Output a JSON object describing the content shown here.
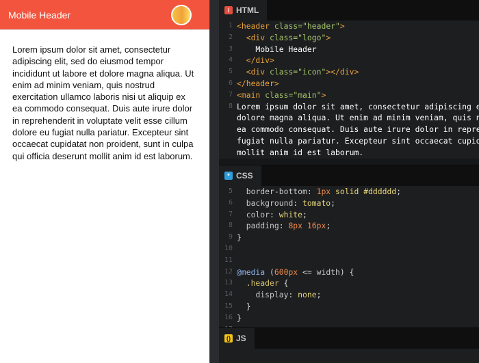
{
  "preview": {
    "header_title": "Mobile Header",
    "body_text": "Lorem ipsum dolor sit amet, consectetur adipiscing elit, sed do eiusmod tempor incididunt ut labore et dolore magna aliqua. Ut enim ad minim veniam, quis nostrud exercitation ullamco laboris nisi ut aliquip ex ea commodo consequat. Duis aute irure dolor in reprehenderit in voluptate velit esse cillum dolore eu fugiat nulla pariatur. Excepteur sint occaecat cupidatat non proident, sunt in culpa qui officia deserunt mollit anim id est laborum.",
    "colors": {
      "header_bg": "#f2543d",
      "header_text": "#ffffff"
    }
  },
  "editors": {
    "html": {
      "tab_label": "HTML",
      "icon": "html-file-icon",
      "lines": [
        {
          "n": "1",
          "segments": [
            [
              "tag",
              "<header "
            ],
            [
              "attr",
              "class="
            ],
            [
              "str",
              "\"header\""
            ],
            [
              "tag",
              ">"
            ]
          ]
        },
        {
          "n": "2",
          "segments": [
            [
              "plain",
              "  "
            ],
            [
              "tag",
              "<div "
            ],
            [
              "attr",
              "class="
            ],
            [
              "str",
              "\"logo\""
            ],
            [
              "tag",
              ">"
            ]
          ]
        },
        {
          "n": "3",
          "segments": [
            [
              "plain",
              "    Mobile Header"
            ]
          ]
        },
        {
          "n": "4",
          "segments": [
            [
              "plain",
              "  "
            ],
            [
              "tag",
              "</div>"
            ]
          ]
        },
        {
          "n": "5",
          "segments": [
            [
              "plain",
              "  "
            ],
            [
              "tag",
              "<div "
            ],
            [
              "attr",
              "class="
            ],
            [
              "str",
              "\"icon\""
            ],
            [
              "tag",
              "></div>"
            ]
          ]
        },
        {
          "n": "6",
          "segments": [
            [
              "tag",
              "</header>"
            ]
          ]
        },
        {
          "n": "7",
          "segments": [
            [
              "tag",
              "<main "
            ],
            [
              "attr",
              "class="
            ],
            [
              "str",
              "\"main\""
            ],
            [
              "tag",
              ">"
            ]
          ]
        },
        {
          "n": "8",
          "segments": [
            [
              "plain",
              "Lorem ipsum dolor sit amet, consectetur adipiscing e"
            ]
          ]
        },
        {
          "n": "",
          "segments": [
            [
              "plain",
              "dolore magna aliqua. Ut enim ad minim veniam, quis n"
            ]
          ]
        },
        {
          "n": "",
          "segments": [
            [
              "plain",
              "ea commodo consequat. Duis aute irure dolor in repre"
            ]
          ]
        },
        {
          "n": "",
          "segments": [
            [
              "plain",
              "fugiat nulla pariatur. Excepteur sint occaecat cupid"
            ]
          ]
        },
        {
          "n": "",
          "segments": [
            [
              "plain",
              "mollit anim id est laborum."
            ]
          ]
        }
      ]
    },
    "css": {
      "tab_label": "CSS",
      "icon": "css-file-icon",
      "lines": [
        {
          "n": "5",
          "segments": [
            [
              "plain",
              "  "
            ],
            [
              "prop",
              "border-bottom"
            ],
            [
              "punc",
              ": "
            ],
            [
              "num",
              "1px"
            ],
            [
              "punc",
              " "
            ],
            [
              "val",
              "solid"
            ],
            [
              "punc",
              " "
            ],
            [
              "val",
              "#dddddd"
            ],
            [
              "punc",
              ";"
            ]
          ]
        },
        {
          "n": "6",
          "segments": [
            [
              "plain",
              "  "
            ],
            [
              "prop",
              "background"
            ],
            [
              "punc",
              ": "
            ],
            [
              "val",
              "tomato"
            ],
            [
              "punc",
              ";"
            ]
          ]
        },
        {
          "n": "7",
          "segments": [
            [
              "plain",
              "  "
            ],
            [
              "prop",
              "color"
            ],
            [
              "punc",
              ": "
            ],
            [
              "val",
              "white"
            ],
            [
              "punc",
              ";"
            ]
          ]
        },
        {
          "n": "8",
          "segments": [
            [
              "plain",
              "  "
            ],
            [
              "prop",
              "padding"
            ],
            [
              "punc",
              ": "
            ],
            [
              "num",
              "8px"
            ],
            [
              "punc",
              " "
            ],
            [
              "num",
              "16px"
            ],
            [
              "punc",
              ";"
            ]
          ]
        },
        {
          "n": "9",
          "segments": [
            [
              "punc",
              "}"
            ]
          ]
        },
        {
          "n": "10",
          "segments": [
            [
              "plain",
              ""
            ]
          ]
        },
        {
          "n": "11",
          "segments": [
            [
              "plain",
              ""
            ]
          ]
        },
        {
          "n": "12",
          "segments": [
            [
              "kw",
              "@media"
            ],
            [
              "punc",
              " ("
            ],
            [
              "num",
              "600px"
            ],
            [
              "punc",
              " <= "
            ],
            [
              "prop",
              "width"
            ],
            [
              "punc",
              ") {"
            ]
          ]
        },
        {
          "n": "13",
          "segments": [
            [
              "plain",
              "  "
            ],
            [
              "sel",
              ".header"
            ],
            [
              "punc",
              " {"
            ]
          ]
        },
        {
          "n": "14",
          "segments": [
            [
              "plain",
              "    "
            ],
            [
              "prop",
              "display"
            ],
            [
              "punc",
              ": "
            ],
            [
              "val",
              "none"
            ],
            [
              "punc",
              ";"
            ]
          ]
        },
        {
          "n": "15",
          "segments": [
            [
              "plain",
              "  "
            ],
            [
              "punc",
              "}"
            ]
          ]
        },
        {
          "n": "16",
          "segments": [
            [
              "punc",
              "}"
            ]
          ]
        },
        {
          "n": "17",
          "segments": [
            [
              "plain",
              ""
            ]
          ]
        }
      ]
    },
    "js": {
      "tab_label": "JS",
      "icon": "js-file-icon"
    }
  }
}
